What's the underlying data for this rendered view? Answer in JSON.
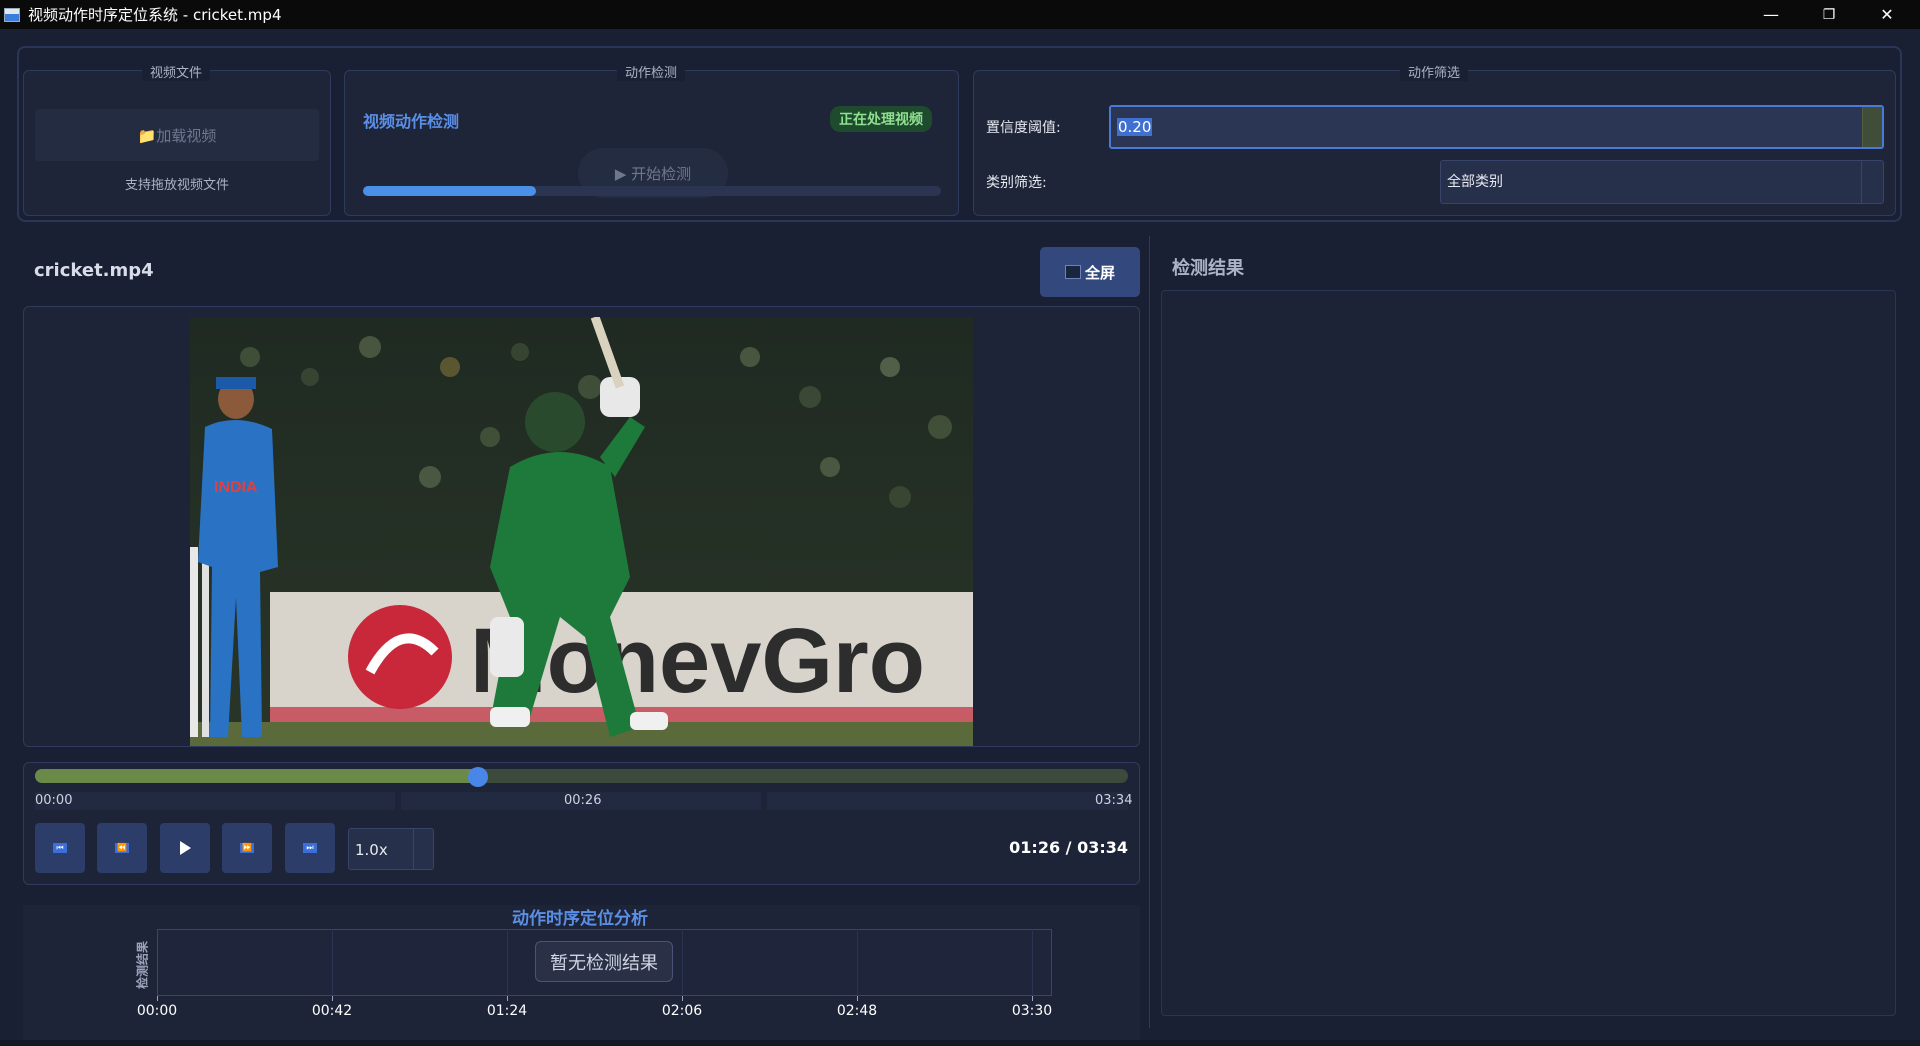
{
  "window": {
    "title": "视频动作时序定位系统 - cricket.mp4",
    "minimize": "—",
    "maximize": "❐",
    "close": "✕"
  },
  "video_file_group": {
    "title": "视频文件",
    "load_button": "📁加载视频",
    "hint": "支持拖放视频文件"
  },
  "detection_group": {
    "title": "动作检测",
    "heading": "视频动作检测",
    "status_badge": "正在处理视频",
    "start_button": "▶ 开始检测",
    "progress": 0.3
  },
  "filter_group": {
    "title": "动作筛选",
    "confidence_label": "置信度阈值:",
    "confidence_value": "0.20",
    "category_label": "类别筛选:",
    "category_value": "全部类别"
  },
  "player": {
    "filename": "cricket.mp4",
    "fullscreen_button": "全屏",
    "seek_progress": 0.405,
    "time_labels": [
      "00:00",
      "00:26",
      "03:34"
    ],
    "speed": "1.0x",
    "time_readout": "01:26 / 03:34",
    "controls": [
      "skip-to-start",
      "rewind",
      "play",
      "fast-forward",
      "skip-to-end"
    ]
  },
  "analysis": {
    "title": "动作时序定位分析",
    "ylabel": "检测结果",
    "xticks": [
      "00:00",
      "00:42",
      "01:24",
      "02:06",
      "02:48",
      "03:30"
    ],
    "empty_message": "暂无检测结果"
  },
  "results": {
    "title": "检测结果"
  },
  "colors": {
    "accent": "#5b8fe6",
    "background": "#1a2033",
    "status_green": "#8fe08f"
  }
}
